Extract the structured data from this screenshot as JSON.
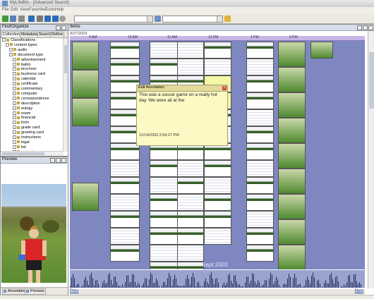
{
  "window": {
    "title": "MyLifeBits - [Advanced Search]"
  },
  "menu": [
    "File",
    "Edit",
    "View",
    "Favorites",
    "Tools",
    "Help"
  ],
  "panes": {
    "find": {
      "title": "Find/Organize",
      "tabs": [
        "Collections",
        "Metadata",
        "Search",
        "Refine"
      ],
      "tree": [
        {
          "label": "Classifications",
          "depth": 0
        },
        {
          "label": "content types",
          "depth": 1
        },
        {
          "label": "audio",
          "depth": 2
        },
        {
          "label": "document type",
          "depth": 2
        },
        {
          "label": "advertisement",
          "depth": 3
        },
        {
          "label": "ballot",
          "depth": 3
        },
        {
          "label": "brochure",
          "depth": 3
        },
        {
          "label": "business card",
          "depth": 3
        },
        {
          "label": "calendar",
          "depth": 3
        },
        {
          "label": "certificate",
          "depth": 3
        },
        {
          "label": "commentary",
          "depth": 3
        },
        {
          "label": "computer",
          "depth": 3
        },
        {
          "label": "correspondence",
          "depth": 3
        },
        {
          "label": "description",
          "depth": 3
        },
        {
          "label": "eulogy",
          "depth": 3
        },
        {
          "label": "exam",
          "depth": 3
        },
        {
          "label": "financial",
          "depth": 3
        },
        {
          "label": "form",
          "depth": 3
        },
        {
          "label": "grade card",
          "depth": 3
        },
        {
          "label": "greeting card",
          "depth": 3
        },
        {
          "label": "instructions",
          "depth": 3
        },
        {
          "label": "legal",
          "depth": 3
        },
        {
          "label": "list",
          "depth": 3
        },
        {
          "label": "name tag",
          "depth": 3
        }
      ]
    },
    "preview": {
      "title": "Preview",
      "tabs": [
        "Annotation",
        "Preview"
      ]
    },
    "items": {
      "title": "Items",
      "start_date": "9/27/2003",
      "ruler_labels": [
        "9 AM",
        "10 AM",
        "11 AM",
        "12 PM",
        "1 PM",
        "2 PM"
      ],
      "footer_label": "Sept 2003",
      "prev_label": "Prev",
      "next_label": "Next"
    }
  },
  "annotation": {
    "title": "Edit Annotation",
    "text": "This was a soccer game on a really hot day. We were all at the",
    "timestamp": "11/14/2003 2:59:27 PM"
  },
  "colors": {
    "timeline_bg": "#7e87c0",
    "ruler_bg": "#c6b6e8",
    "note_bg": "#fcf9c4"
  },
  "icons": [
    "back-icon",
    "forward-icon",
    "home-icon",
    "search-icon",
    "pin-icon",
    "close-icon",
    "folder-icon"
  ]
}
